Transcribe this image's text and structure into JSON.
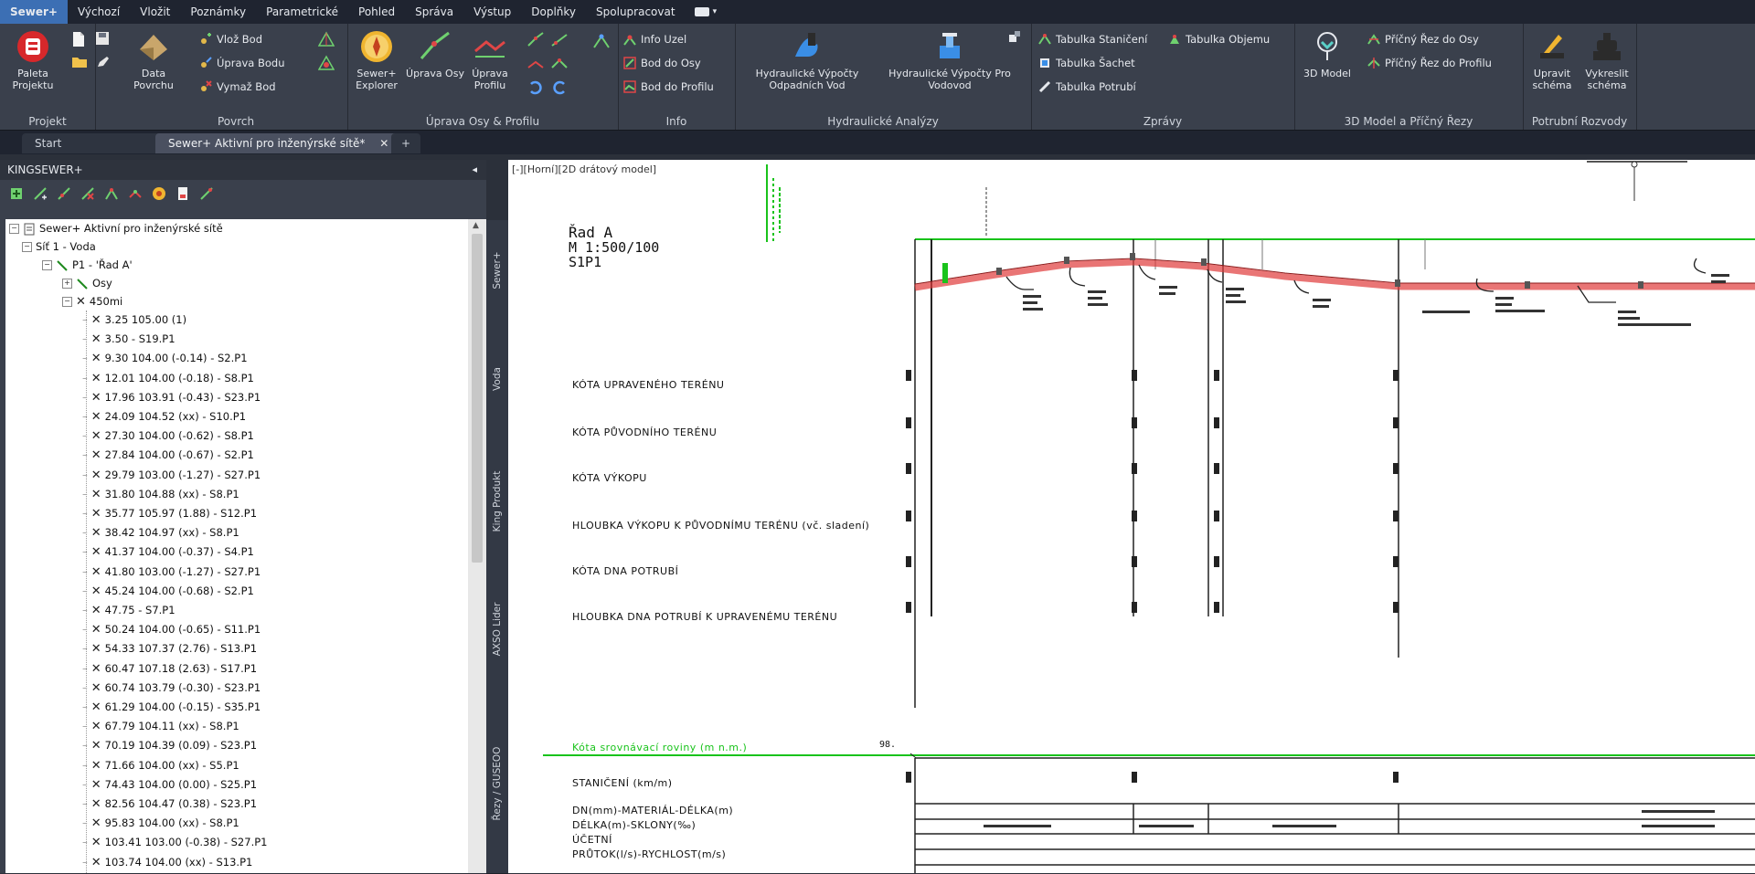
{
  "menu": {
    "items": [
      "Sewer+",
      "Výchozí",
      "Vložit",
      "Poznámky",
      "Parametrické",
      "Pohled",
      "Správa",
      "Výstup",
      "Doplňky",
      "Spolupracovat"
    ],
    "active_index": 0
  },
  "ribbon": {
    "projekt": {
      "title": "Projekt",
      "paleta_label": "Paleta Projektu"
    },
    "povrch": {
      "title": "Povrch",
      "data_povrchu": "Data Povrchu",
      "vlozit_bod": "Vlož Bod",
      "uprava_bodu": "Úprava Bodu",
      "vymaz_bod": "Vymaž Bod"
    },
    "upravy": {
      "title": "Úprava Osy & Profilu",
      "explorer": "Sewer+ Explorer",
      "uprava_osy": "Úprava Osy",
      "uprava_profilu": "Úprava Profilu"
    },
    "info": {
      "title": "Info",
      "info_uzel": "Info Uzel",
      "bod_do_osy": "Bod do Osy",
      "bod_do_profilu": "Bod do Profilu"
    },
    "hydraulika": {
      "title": "Hydraulické Analýzy",
      "odpadnich": "Hydraulické Výpočty Odpadních Vod",
      "vodovod": "Hydraulické Výpočty Pro Vodovod"
    },
    "zpravy": {
      "title": "Zprávy",
      "staniceni": "Tabulka Staničení",
      "objemu": "Tabulka Objemu",
      "sachet": "Tabulka Šachet",
      "potrubi": "Tabulka Potrubí"
    },
    "model3d": {
      "title": "3D Model a Příčný Řezy",
      "model": "3D Model",
      "rez_osy": "Příčný Řez do Osy",
      "rez_profilu": "Příčný Řez do Profilu"
    },
    "rozvody": {
      "title": "Potrubní Rozvody",
      "upravit": "Upravit schéma",
      "vykreslit": "Vykreslit schéma"
    }
  },
  "tabs": [
    {
      "label": "Start"
    },
    {
      "label": "Sewer+ Aktivní pro inženýrské sítě*"
    }
  ],
  "palette": {
    "header": "KINGSEWER+",
    "tree": {
      "root": "Sewer+ Aktivní pro inženýrské sítě",
      "network": "Síť 1 - Voda",
      "route": "P1 - 'Řad A'",
      "osy": "Osy",
      "profile": "450mi",
      "nodes": [
        "3.25 105.00 (1)",
        "3.50 - S19.P1",
        "9.30 104.00 (-0.14) - S2.P1",
        "12.01 104.00 (-0.18) - S8.P1",
        "17.96 103.91 (-0.43) - S23.P1",
        "24.09 104.52 (xx) - S10.P1",
        "27.30 104.00 (-0.62) - S8.P1",
        "27.84 104.00 (-0.67) - S2.P1",
        "29.79 103.00 (-1.27) - S27.P1",
        "31.80 104.88 (xx) - S8.P1",
        "35.77 105.97 (1.88) - S12.P1",
        "38.42 104.97 (xx) - S8.P1",
        "41.37 104.00 (-0.37) - S4.P1",
        "41.80 103.00 (-1.27) - S27.P1",
        "45.24 104.00 (-0.68) - S2.P1",
        "47.75 - S7.P1",
        "50.24 104.00 (-0.65) - S11.P1",
        "54.33 107.37 (2.76) - S13.P1",
        "60.47 107.18 (2.63) - S17.P1",
        "60.74 103.79 (-0.30) - S23.P1",
        "61.29 104.00 (-0.15) - S35.P1",
        "67.79 104.11 (xx) - S8.P1",
        "70.19 104.39 (0.09) - S23.P1",
        "71.66 104.00 (xx) - S5.P1",
        "74.43 104.00 (0.00) - S25.P1",
        "82.56 104.47 (0.38) - S23.P1",
        "95.83 104.00 (xx) - S8.P1",
        "103.41 103.00 (-0.38) - S27.P1",
        "103.74 104.00 (xx) - S13.P1"
      ]
    },
    "side_tabs": [
      "Sewer+",
      "Voda",
      "King Produkt",
      "AXSO Lider",
      "Řezy / GUSEOO"
    ]
  },
  "drawing": {
    "viewport_label": "[-][Horní][2D drátový model]",
    "title_lines": [
      "Řad A",
      "M 1:500/100",
      "S1P1"
    ],
    "rows": [
      "KÓTA UPRAVENÉHO TERÉNU",
      "KÓTA PŮVODNÍHO TERÉNU",
      "KÓTA VÝKOPU",
      "HLOUBKA VÝKOPU K PŮVODNÍMU TERÉNU (vč. sladení)",
      "KÓTA DNA POTRUBÍ",
      "HLOUBKA DNA POTRUBÍ K UPRAVENÉMU TERÉNU",
      "Kóta srovnávací roviny (m n.m.)",
      "STANIČENÍ (km/m)",
      "DN(mm)-MATERIÁL-DÉLKA(m)",
      "DÉLKA(m)-SKLONY(‰)",
      "ÚČETNÍ",
      "PRŮTOK(l/s)-RYCHLOST(m/s)"
    ],
    "datum_value": "98.",
    "colors": {
      "pipe": "#e03a3a",
      "terrain": "#19c31b",
      "accent": "#3c6fb4"
    }
  }
}
